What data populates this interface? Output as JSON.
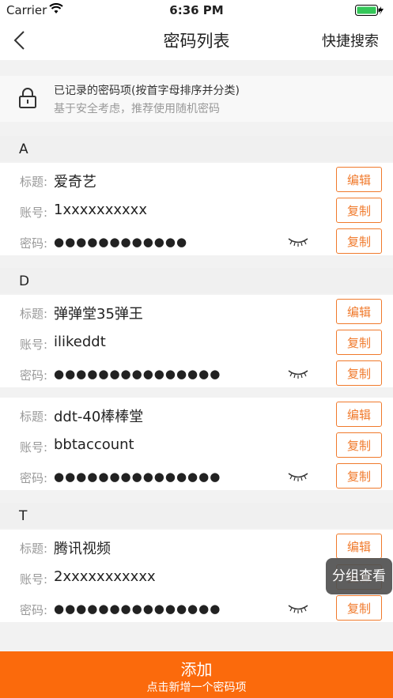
{
  "status_bar": {
    "carrier": "Carrier",
    "time": "6:36 PM"
  },
  "nav": {
    "title": "密码列表",
    "quick_search": "快捷搜索"
  },
  "notice": {
    "line1": "已记录的密码项(按首字母排序并分类)",
    "line2": "基于安全考虑，推荐使用随机密码"
  },
  "labels": {
    "title": "标题:",
    "account": "账号:",
    "password": "密码:"
  },
  "buttons": {
    "edit": "编辑",
    "copy": "复制"
  },
  "sections": [
    {
      "letter": "A",
      "entries": [
        {
          "title": "爱奇艺",
          "account": "1xxxxxxxxxx",
          "password_mask": "●●●●●●●●●●●●"
        }
      ]
    },
    {
      "letter": "D",
      "entries": [
        {
          "title": "弹弹堂35弹王",
          "account": "ilikeddt",
          "password_mask": "●●●●●●●●●●●●●●●"
        },
        {
          "title": "ddt-40棒棒堂",
          "account": "bbtaccount",
          "password_mask": "●●●●●●●●●●●●●●●"
        }
      ]
    },
    {
      "letter": "T",
      "entries": [
        {
          "title": "腾讯视频",
          "account": "2xxxxxxxxxxx",
          "password_mask": "●●●●●●●●●●●●●●●"
        }
      ]
    }
  ],
  "floating": {
    "group_view": "分组查看"
  },
  "add_bar": {
    "main": "添加",
    "sub": "点击新增一个密码项"
  },
  "colors": {
    "accent": "#fb6a0c",
    "button_border": "#f07a2c"
  },
  "icons": {
    "back": "chevron-left-icon",
    "lock": "lock-icon",
    "eye": "eye-closed-icon",
    "wifi": "wifi-icon",
    "battery": "battery-icon"
  }
}
